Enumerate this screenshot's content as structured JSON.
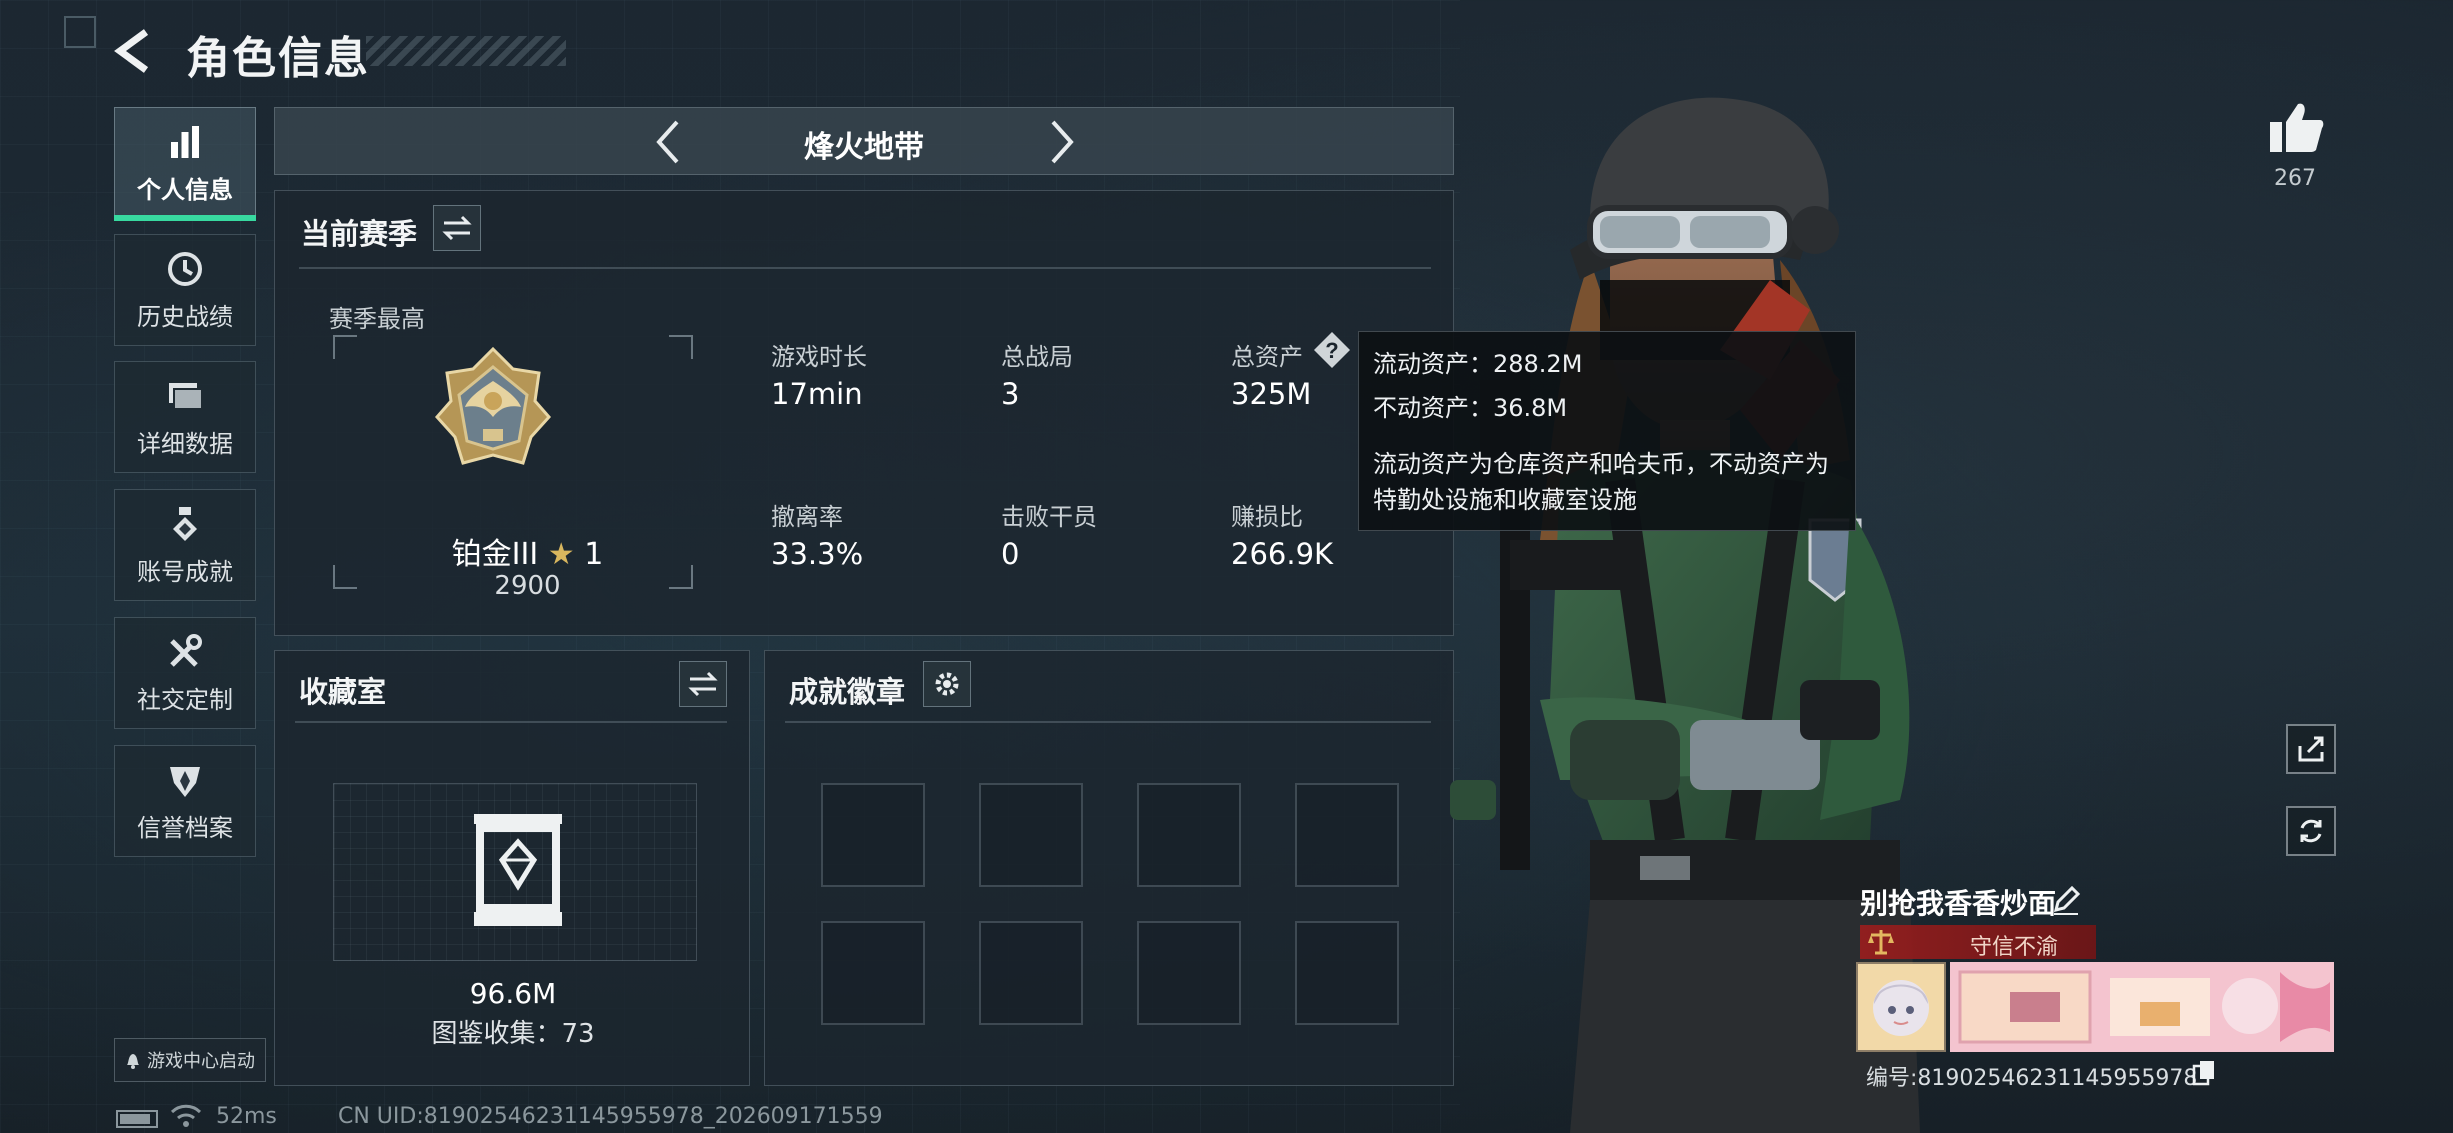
{
  "header": {
    "title": "角色信息"
  },
  "sidebar": {
    "items": [
      {
        "label": "个人信息",
        "icon": "bar-chart-icon",
        "active": true
      },
      {
        "label": "历史战绩",
        "icon": "history-clock-icon",
        "active": false
      },
      {
        "label": "详细数据",
        "icon": "folder-stack-icon",
        "active": false
      },
      {
        "label": "账号成就",
        "icon": "medal-icon",
        "active": false
      },
      {
        "label": "社交定制",
        "icon": "tools-icon",
        "active": false
      },
      {
        "label": "信誉档案",
        "icon": "shield-emblem-icon",
        "active": false
      }
    ],
    "accent": "#38d9a0"
  },
  "mode_selector": {
    "current": "烽火地带"
  },
  "season": {
    "title": "当前赛季",
    "best_label": "赛季最高",
    "rank_name": "铂金III",
    "rank_stars": "1",
    "rank_points": "2900",
    "stats": [
      {
        "label": "游戏时长",
        "value": "17min"
      },
      {
        "label": "总战局",
        "value": "3"
      },
      {
        "label": "总资产",
        "value": "325M"
      },
      {
        "label": "撤离率",
        "value": "33.3%"
      },
      {
        "label": "击败干员",
        "value": "0"
      },
      {
        "label": "赚损比",
        "value": "266.9K"
      }
    ]
  },
  "tooltip": {
    "line1": "流动资产：288.2M",
    "line2": "不动资产：36.8M",
    "line3": "流动资产为仓库资产和哈夫币，不动资产为",
    "line4": "特勤处设施和收藏室设施"
  },
  "collection": {
    "title": "收藏室",
    "value": "96.6M",
    "catalog": "图鉴收集：73"
  },
  "badges": {
    "title": "成就徽章",
    "slot_count": 8
  },
  "profile": {
    "likes": "267",
    "player_name": "别抢我香香炒面",
    "trust_label": "守信不渝",
    "uid_display": "编号:81902546231145955978"
  },
  "footer": {
    "game_center": "游戏中心启动",
    "ping": "52ms",
    "uid_full": "CN UID:81902546231145955978_202609171559"
  },
  "colors": {
    "trust_red": "#962020",
    "gold": "#c9a45a"
  }
}
